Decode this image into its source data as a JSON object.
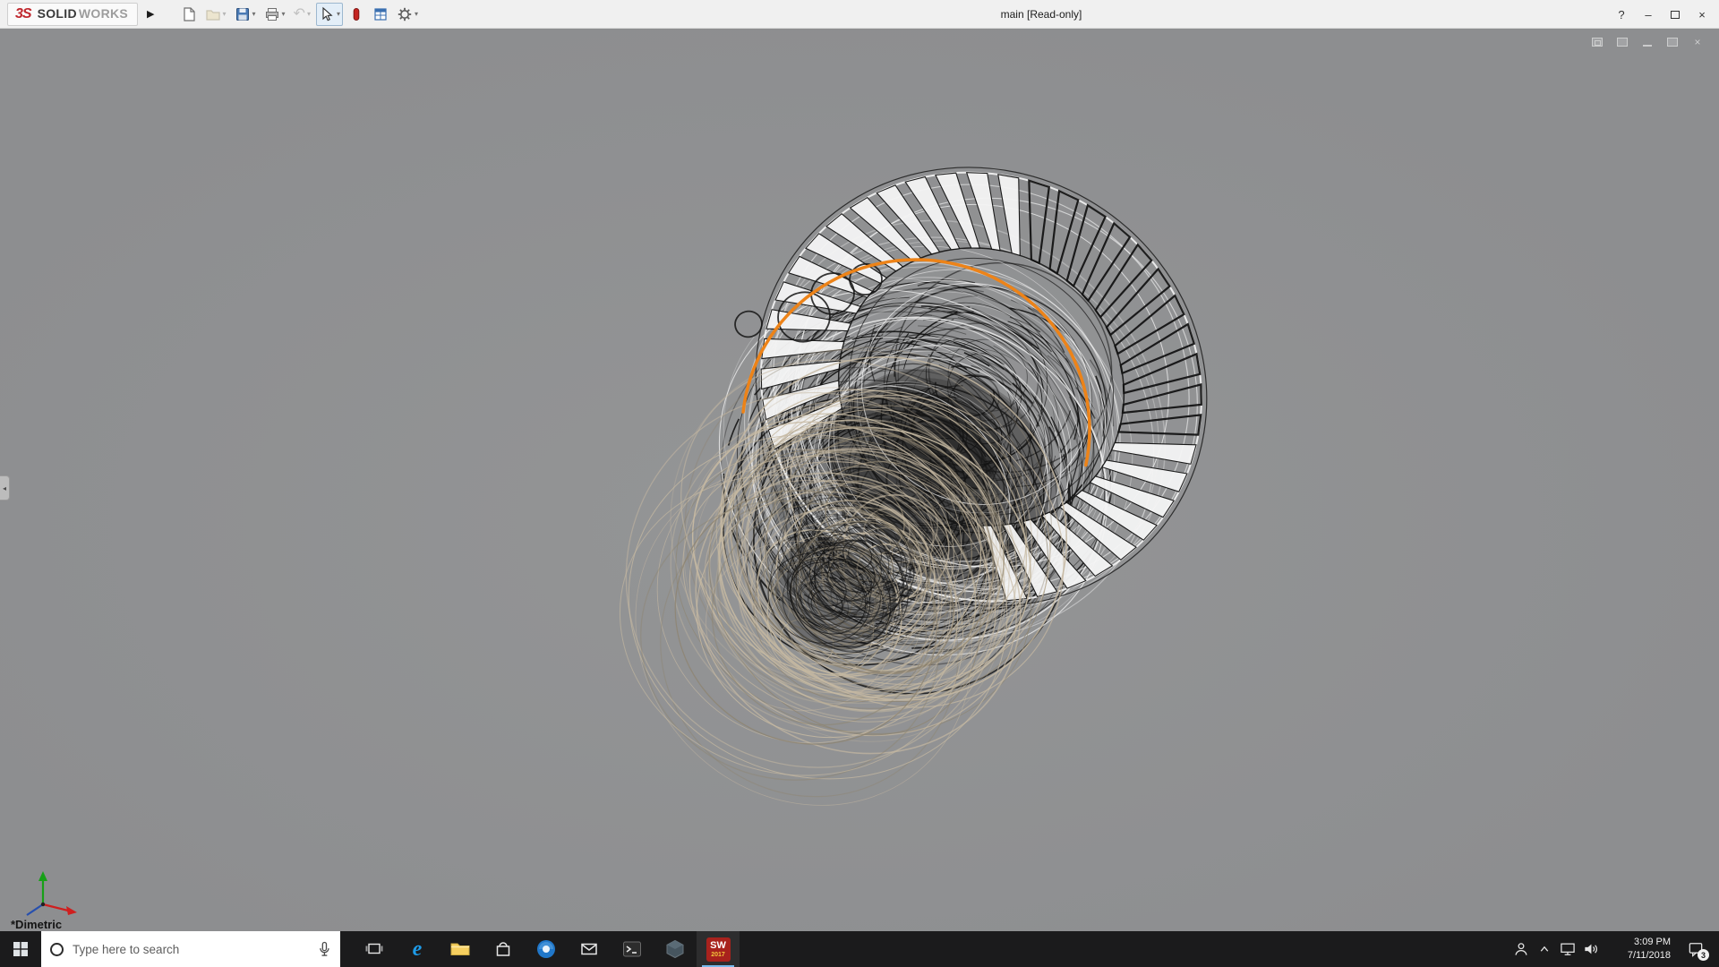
{
  "titlebar": {
    "brand": {
      "prefix": "3S",
      "solid": "SOLID",
      "works": "WORKS"
    },
    "expand_arrow": "▶",
    "dropdown_glyph": "▾",
    "document_title": "main [Read-only]",
    "toolbar_icons": [
      "new-document",
      "open",
      "save",
      "print",
      "undo",
      "select",
      "appearances",
      "design-table",
      "options"
    ],
    "controls": {
      "help": "?",
      "minimize": "–",
      "close": "×"
    }
  },
  "viewport": {
    "background": "#8f9092",
    "view_orientation_label": "*Dimetric",
    "panel_tab_glyph": "◂",
    "child_controls": {
      "minimize": "–",
      "close": "×"
    },
    "engine": {
      "colors": {
        "dark": "#141414",
        "tan": "#c6b9a2",
        "tan_dark": "#8e8470",
        "white": "#f5f5f5",
        "highlight": "#ed8318"
      },
      "center_front": [
        930,
        635
      ],
      "center_rear": [
        1096,
        400
      ],
      "blade_count": 44,
      "ring_outer_radius": 250,
      "ring_inner_radius": 162
    }
  },
  "taskbar": {
    "search_placeholder": "Type here to search",
    "pinned_apps": [
      "task-view",
      "edge",
      "file-explorer",
      "store",
      "round-app",
      "mail",
      "command-prompt",
      "cube-app",
      "solidworks-2017"
    ],
    "solidworks_icon": {
      "top": "SW",
      "year": "2017"
    },
    "clock": {
      "time": "3:09 PM",
      "date": "7/11/2018"
    },
    "notification_badge": "3"
  }
}
